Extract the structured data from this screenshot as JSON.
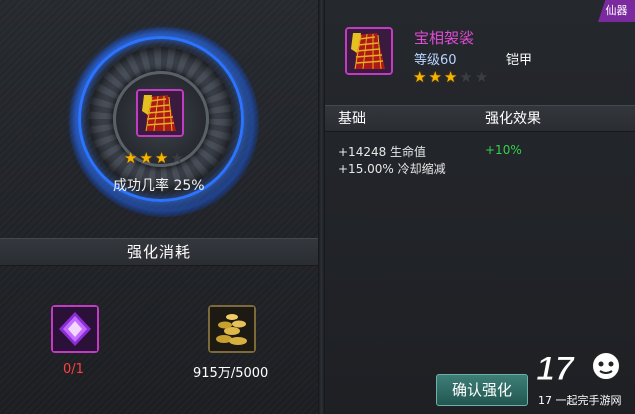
{
  "badge": {
    "label": "仙器"
  },
  "enhance_preview": {
    "stars_filled": 3,
    "stars_total": 4,
    "success_rate_text": "成功几率 25%"
  },
  "cost": {
    "header": "强化消耗",
    "crystal_count": "0/1",
    "gold_count": "915万/5000"
  },
  "item": {
    "name": "宝相袈裟",
    "level": "等级60",
    "type": "铠甲",
    "stars_filled": 3,
    "stars_total": 5
  },
  "stats": {
    "header_base": "基础",
    "header_effect": "强化效果",
    "lines": [
      "+14248 生命值",
      "+15.00% 冷却缩减"
    ],
    "bonus": "+10%"
  },
  "buttons": {
    "confirm_label": "确认强化"
  },
  "watermark": {
    "text": "17 一起完手游网"
  },
  "colors": {
    "rarity": "#c13cc3",
    "accent_blue": "#2b74ff",
    "bonus_green": "#35d24a"
  }
}
